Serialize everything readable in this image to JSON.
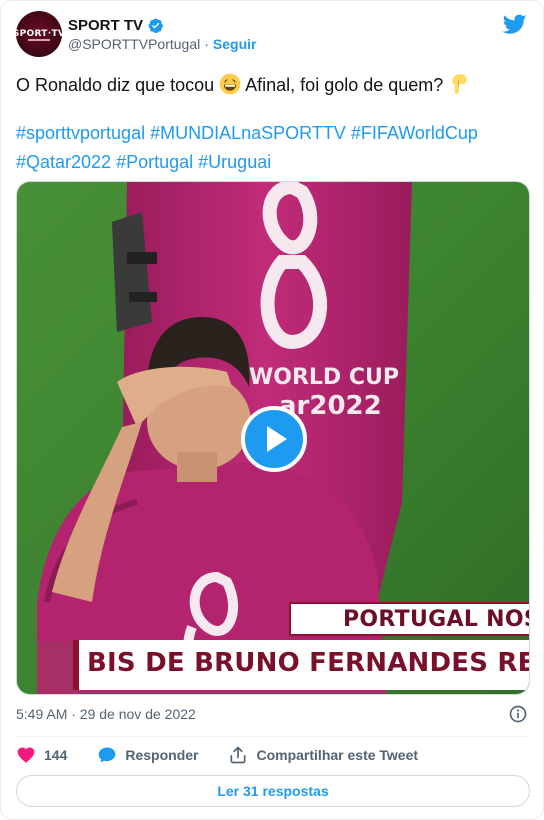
{
  "account": {
    "display_name": "SPORT TV",
    "handle": "@SPORTTVPortugal",
    "separator": "·",
    "follow_label": "Seguir",
    "avatar_text": "SPORT·TV",
    "verified": true,
    "platform_icon": "twitter-bird-icon"
  },
  "tweet": {
    "text_before_emoji": "O Ronaldo diz que tocou ",
    "emoji_1": "grinning-face-emoji",
    "text_after_emoji": " Afinal, foi golo de quem? ",
    "emoji_2": "backhand-index-pointing-down-emoji",
    "hashtags_line1": [
      "#sporttvportugal",
      "#MUNDIALnaSPORTTV",
      "#FIFAWorldCup"
    ],
    "hashtags_line2": [
      "#Qatar2022",
      "#Portugal",
      "#Uruguai"
    ]
  },
  "media": {
    "type": "video",
    "play_icon": "play-icon",
    "bib_text_line1": "WORLD CUP",
    "bib_text_line2": "ar2022",
    "lower_third_top": "PORTUGAL NOS",
    "lower_third_bottom": "BIS DE BRUNO FERNANDES RES"
  },
  "meta": {
    "timestamp": "5:49 AM · 29 de nov de 2022",
    "info_icon": "info-icon"
  },
  "actions": {
    "like_count": "144",
    "reply_label": "Responder",
    "share_label": "Compartilhar este Tweet",
    "read_replies_label": "Ler 31 respostas"
  },
  "colors": {
    "accent": "#1d9bf0",
    "like": "#f91880",
    "text_primary": "#0f1419",
    "text_secondary": "#536471",
    "bib_magenta": "#b0246e",
    "pitch_green": "#3f8a33",
    "sport_tv_maroon": "#6c0f26"
  }
}
